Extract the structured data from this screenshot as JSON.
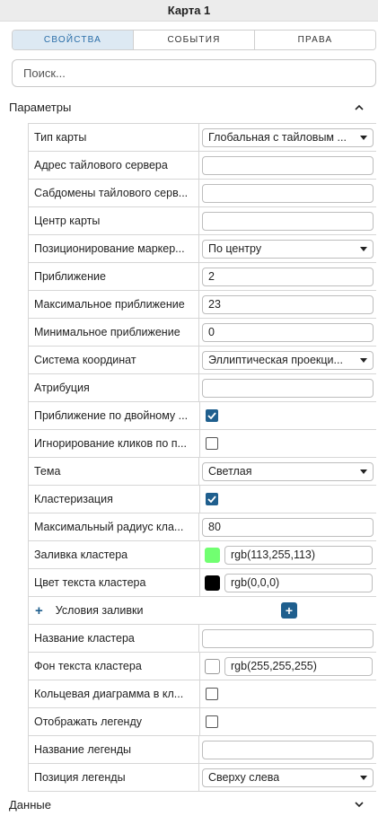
{
  "panel": {
    "title": "Карта 1"
  },
  "tabs": [
    {
      "label": "СВОЙСТВА",
      "active": true
    },
    {
      "label": "СОБЫТИЯ",
      "active": false
    },
    {
      "label": "ПРАВА",
      "active": false
    }
  ],
  "search": {
    "placeholder": "Поиск..."
  },
  "sections": {
    "params": {
      "label": "Параметры",
      "expanded": true
    },
    "data": {
      "label": "Данные",
      "expanded": false
    }
  },
  "properties": {
    "map_type": {
      "label": "Тип карты",
      "value": "Глобальная с тайловым ..."
    },
    "tile_server": {
      "label": "Адрес тайлового сервера",
      "value": ""
    },
    "tile_subdomains": {
      "label": "Сабдомены тайлового серв...",
      "value": ""
    },
    "map_center": {
      "label": "Центр карты",
      "value": ""
    },
    "marker_position": {
      "label": "Позиционирование маркер...",
      "value": "По центру"
    },
    "zoom": {
      "label": "Приближение",
      "value": "2"
    },
    "max_zoom": {
      "label": "Максимальное приближение",
      "value": "23"
    },
    "min_zoom": {
      "label": "Минимальное приближение",
      "value": "0"
    },
    "coord_system": {
      "label": "Система координат",
      "value": "Эллиптическая проекци..."
    },
    "attribution": {
      "label": "Атрибуция",
      "value": ""
    },
    "dblclick_zoom": {
      "label": "Приближение по двойному ...",
      "checked": true
    },
    "ignore_clicks": {
      "label": "Игнорирование кликов по п...",
      "checked": false
    },
    "theme": {
      "label": "Тема",
      "value": "Светлая"
    },
    "clustering": {
      "label": "Кластеризация",
      "checked": true
    },
    "max_cluster_radius": {
      "label": "Максимальный радиус кла...",
      "value": "80"
    },
    "cluster_fill": {
      "label": "Заливка кластера",
      "value": "rgb(113,255,113)",
      "color": "#71ff71"
    },
    "cluster_text_color": {
      "label": "Цвет текста кластера",
      "value": "rgb(0,0,0)",
      "color": "#000000"
    },
    "fill_conditions": {
      "label": "Условия заливки"
    },
    "cluster_name": {
      "label": "Название кластера",
      "value": ""
    },
    "cluster_text_bg": {
      "label": "Фон текста кластера",
      "value": "rgb(255,255,255)",
      "color": "#ffffff"
    },
    "donut_chart": {
      "label": "Кольцевая диаграмма в кл...",
      "checked": false
    },
    "show_legend": {
      "label": "Отображать легенду",
      "checked": false
    },
    "legend_name": {
      "label": "Название легенды",
      "value": ""
    },
    "legend_position": {
      "label": "Позиция легенды",
      "value": "Сверху слева"
    }
  }
}
